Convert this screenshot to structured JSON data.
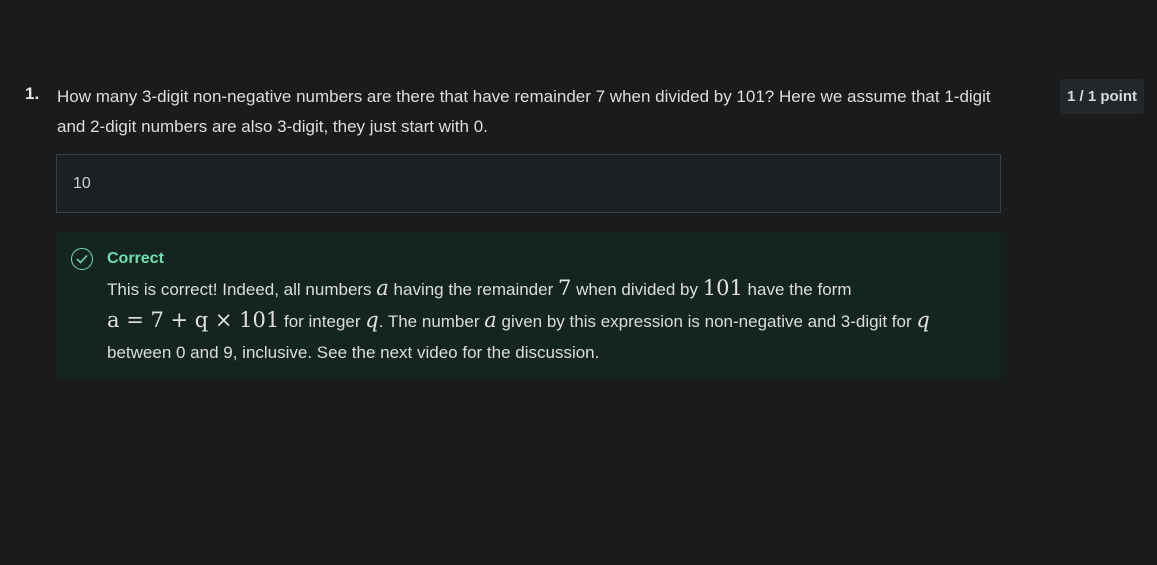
{
  "question": {
    "number": "1.",
    "text": "How many 3-digit non-negative numbers are there that have remainder 7 when divided by 101? Here we assume that 1-digit and 2-digit numbers are also 3-digit, they just start with 0.",
    "points": "1 / 1 point"
  },
  "answer": {
    "value": "10"
  },
  "feedback": {
    "icon": "check-circle-icon",
    "status": "Correct",
    "status_color": "#6ee0b0",
    "t1": "This is correct! Indeed, all numbers ",
    "m_a1": "a",
    "t2": " having the remainder ",
    "m_7": "7",
    "t3": " when divided by ",
    "m_101": "101",
    "t4": " have the form ",
    "m_expr": "a = 7 + q × 101",
    "t5": " for integer ",
    "m_q1": "q",
    "t6": ". The number ",
    "m_a2": "a",
    "t7": " given by this expression is non-negative and 3-digit for ",
    "m_q2": "q",
    "t8": " between 0 and 9, inclusive. See the next video for the discussion."
  }
}
